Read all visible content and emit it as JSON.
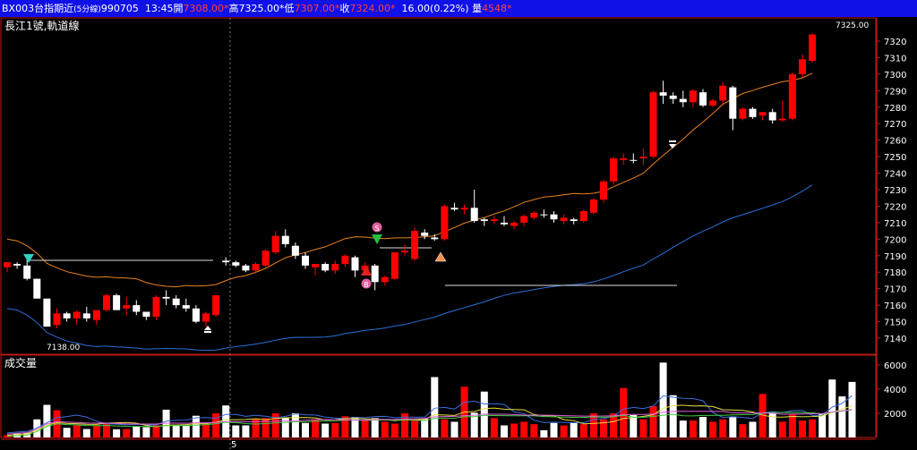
{
  "header": {
    "symbol": "BX003",
    "name": "台指期近",
    "interval": "(5分線)",
    "date": "990705",
    "time": "13:45",
    "open_label": "開",
    "open": "7308.00*",
    "high_label": "高",
    "high": "7325.00*",
    "low_label": "低",
    "low": "7307.00*",
    "close_label": "收",
    "close": "7324.00*",
    "change": "16.00(0.22%)",
    "volume_label": "量",
    "volume": "4548*"
  },
  "price_panel": {
    "title": "長江1號,軌道線",
    "max_label": "7325.00",
    "min_label": "7138.00"
  },
  "volume_panel": {
    "title": "成交量"
  },
  "x_axis": {
    "day_marker": "5"
  },
  "colors": {
    "up": "#ff0000",
    "down": "#ffffff",
    "orange_line": "#e8821e",
    "blue_line": "#2a6fd8",
    "background": "#000000",
    "title_bg": "#1010e8"
  },
  "chart_data": [
    {
      "type": "candlestick",
      "ylim": [
        7130,
        7330
      ],
      "yticks": [
        7140,
        7150,
        7160,
        7170,
        7180,
        7190,
        7200,
        7210,
        7220,
        7230,
        7240,
        7250,
        7260,
        7270,
        7280,
        7290,
        7300,
        7310,
        7320
      ],
      "candles": [
        [
          7183,
          7186,
          7180,
          7186
        ],
        [
          7185,
          7186,
          7182,
          7184
        ],
        [
          7184,
          7188,
          7175,
          7176
        ],
        [
          7176,
          7176,
          7164,
          7164
        ],
        [
          7164,
          7164,
          7147,
          7147
        ],
        [
          7148,
          7158,
          7146,
          7155
        ],
        [
          7155,
          7156,
          7150,
          7152
        ],
        [
          7152,
          7157,
          7148,
          7156
        ],
        [
          7155,
          7159,
          7150,
          7152
        ],
        [
          7151,
          7157,
          7148,
          7157
        ],
        [
          7157,
          7167,
          7156,
          7166
        ],
        [
          7166,
          7167,
          7157,
          7157
        ],
        [
          7158,
          7165,
          7154,
          7160
        ],
        [
          7160,
          7163,
          7154,
          7156
        ],
        [
          7156,
          7156,
          7151,
          7153
        ],
        [
          7153,
          7166,
          7151,
          7165
        ],
        [
          7165,
          7169,
          7160,
          7164
        ],
        [
          7164,
          7166,
          7158,
          7160
        ],
        [
          7160,
          7164,
          7156,
          7158
        ],
        [
          7158,
          7160,
          7149,
          7150
        ],
        [
          7150,
          7156,
          7147,
          7155
        ],
        [
          7154,
          7166,
          7153,
          7166
        ],
        [
          7187,
          7189,
          7184,
          7186
        ],
        [
          7186,
          7187,
          7183,
          7184
        ],
        [
          7184,
          7185,
          7180,
          7181
        ],
        [
          7181,
          7186,
          7179,
          7185
        ],
        [
          7184,
          7194,
          7183,
          7193
        ],
        [
          7192,
          7205,
          7191,
          7202
        ],
        [
          7202,
          7206,
          7195,
          7197
        ],
        [
          7196,
          7198,
          7188,
          7190
        ],
        [
          7190,
          7192,
          7182,
          7184
        ],
        [
          7183,
          7185,
          7178,
          7185
        ],
        [
          7185,
          7186,
          7180,
          7181
        ],
        [
          7181,
          7187,
          7179,
          7185
        ],
        [
          7185,
          7191,
          7183,
          7190
        ],
        [
          7189,
          7190,
          7177,
          7181
        ],
        [
          7181,
          7186,
          7178,
          7184
        ],
        [
          7184,
          7185,
          7169,
          7174
        ],
        [
          7174,
          7178,
          7172,
          7177
        ],
        [
          7176,
          7192,
          7175,
          7192
        ],
        [
          7192,
          7197,
          7190,
          7193
        ],
        [
          7188,
          7207,
          7187,
          7205
        ],
        [
          7204,
          7206,
          7200,
          7202
        ],
        [
          7201,
          7203,
          7199,
          7200
        ],
        [
          7200,
          7221,
          7199,
          7220
        ],
        [
          7219,
          7222,
          7217,
          7218
        ],
        [
          7218,
          7221,
          7215,
          7219
        ],
        [
          7219,
          7230,
          7210,
          7211
        ],
        [
          7212,
          7213,
          7208,
          7211
        ],
        [
          7211,
          7214,
          7209,
          7212
        ],
        [
          7210,
          7214,
          7208,
          7209
        ],
        [
          7208,
          7211,
          7206,
          7210
        ],
        [
          7210,
          7215,
          7208,
          7214
        ],
        [
          7213,
          7217,
          7212,
          7216
        ],
        [
          7215,
          7218,
          7213,
          7215
        ],
        [
          7215,
          7217,
          7210,
          7212
        ],
        [
          7211,
          7215,
          7209,
          7213
        ],
        [
          7212,
          7213,
          7209,
          7211
        ],
        [
          7211,
          7218,
          7210,
          7217
        ],
        [
          7216,
          7225,
          7215,
          7224
        ],
        [
          7224,
          7236,
          7222,
          7235
        ],
        [
          7235,
          7250,
          7233,
          7249
        ],
        [
          7248,
          7252,
          7245,
          7249
        ],
        [
          7248,
          7252,
          7246,
          7248
        ],
        [
          7249,
          7255,
          7245,
          7250
        ],
        [
          7250,
          7290,
          7249,
          7289
        ],
        [
          7289,
          7296,
          7282,
          7287
        ],
        [
          7287,
          7289,
          7282,
          7285
        ],
        [
          7285,
          7290,
          7280,
          7283
        ],
        [
          7283,
          7291,
          7280,
          7290
        ],
        [
          7289,
          7291,
          7280,
          7281
        ],
        [
          7281,
          7285,
          7280,
          7284
        ],
        [
          7284,
          7295,
          7281,
          7293
        ],
        [
          7292,
          7293,
          7266,
          7273
        ],
        [
          7273,
          7280,
          7272,
          7279
        ],
        [
          7279,
          7280,
          7273,
          7274
        ],
        [
          7275,
          7276,
          7272,
          7277
        ],
        [
          7277,
          7279,
          7270,
          7272
        ],
        [
          7272,
          7284,
          7271,
          7273
        ],
        [
          7273,
          7301,
          7272,
          7300
        ],
        [
          7300,
          7312,
          7298,
          7309
        ],
        [
          7308,
          7325,
          7307,
          7324
        ]
      ],
      "volumes": [
        180,
        320,
        400,
        1500,
        2700,
        2250,
        800,
        1000,
        700,
        1000,
        1150,
        680,
        700,
        900,
        850,
        1000,
        2300,
        1050,
        1000,
        1800,
        1100,
        2000,
        2650,
        1000,
        1000,
        1550,
        1600,
        2000,
        1600,
        2000,
        1200,
        1500,
        1150,
        1200,
        1750,
        1700,
        1400,
        1600,
        1300,
        1150,
        2000,
        1400,
        1550,
        5000,
        1500,
        1300,
        4200,
        2050,
        3800,
        1600,
        1000,
        1150,
        1300,
        1100,
        600,
        1200,
        1000,
        1200,
        1100,
        2000,
        1500,
        2000,
        4100,
        1850,
        1500,
        2600,
        6200,
        3500,
        1400,
        1400,
        1700,
        1300,
        1500,
        1700,
        1100,
        1300,
        3600,
        2000,
        1300,
        1900,
        1400,
        1500,
        2000,
        4800,
        3400,
        4600
      ],
      "volume_yticks": [
        2000,
        4000,
        6000
      ],
      "volume_ylim": [
        0,
        6500
      ]
    }
  ]
}
